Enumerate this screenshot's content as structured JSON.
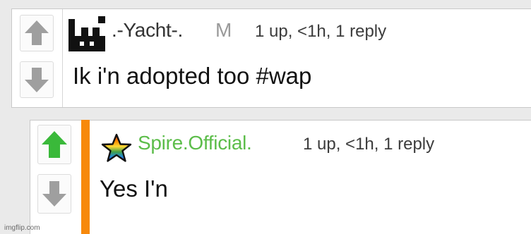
{
  "comments": [
    {
      "username": ".-Yacht-.",
      "badge": "M",
      "meta": "1 up, <1h, 1 reply",
      "text": "Ik i'n adopted too #wap",
      "upvoted": false
    },
    {
      "username": "Spire.Official.",
      "meta": "1 up, <1h, 1 reply",
      "text": "Yes I'n",
      "upvoted": true
    }
  ],
  "icons": {
    "upvote": "arrow-up-icon",
    "downvote": "arrow-down-icon",
    "avatar": "pixel-avatar",
    "user_badge": "rainbow-star-icon"
  },
  "colors": {
    "upvote_active": "#3ab93a",
    "vote_inactive": "#9f9f9f",
    "username_highlight": "#5cbd4a",
    "reply_bar": "#f7890c",
    "background": "#eaeaea"
  },
  "watermark": "imgflip.com"
}
